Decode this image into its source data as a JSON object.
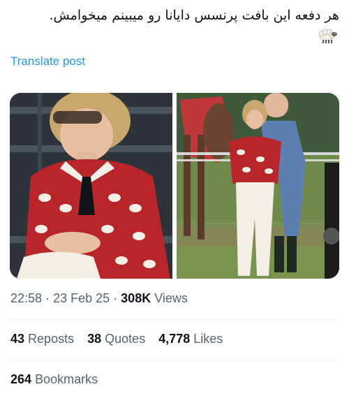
{
  "post": {
    "text": "هر دفعه این بافت پرنسس دایانا رو میبینم میخوامش.",
    "emoji": "sheep"
  },
  "translate_label": "Translate post",
  "meta": {
    "time": "22:58",
    "separator": "·",
    "date": "23 Feb 25",
    "views_count": "308K",
    "views_label": "Views"
  },
  "stats": {
    "reposts_count": "43",
    "reposts_label": "Reposts",
    "quotes_count": "38",
    "quotes_label": "Quotes",
    "likes_count": "4,778",
    "likes_label": "Likes"
  },
  "bookmarks": {
    "count": "264",
    "label": "Bookmarks"
  },
  "colors": {
    "link": "#1d9bf0",
    "secondary_text": "#536471",
    "primary_text": "#0f1419",
    "sweater_red": "#b8262b"
  }
}
